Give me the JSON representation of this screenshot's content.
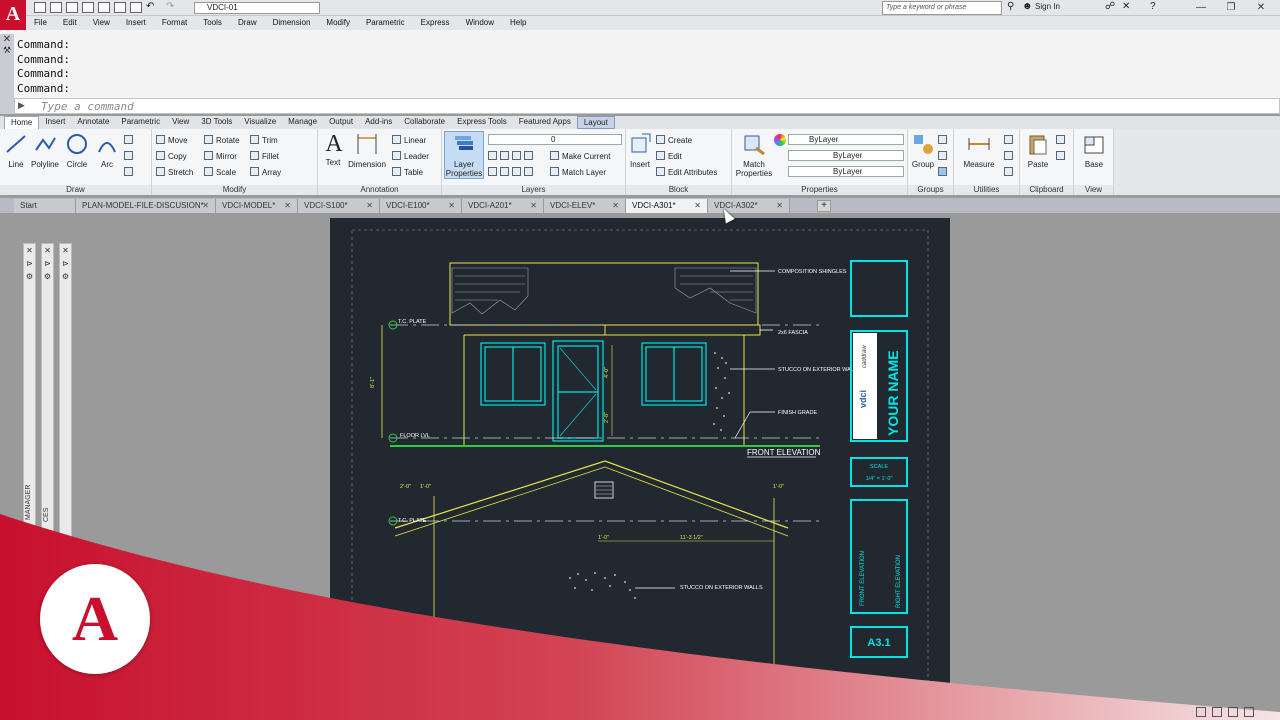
{
  "window": {
    "app_logo": "A",
    "workspace_value": "VDCI-01",
    "search_placeholder": "Type a keyword or phrase",
    "sign_in": "Sign In"
  },
  "menu": [
    "File",
    "Edit",
    "View",
    "Insert",
    "Format",
    "Tools",
    "Draw",
    "Dimension",
    "Modify",
    "Parametric",
    "Express",
    "Window",
    "Help"
  ],
  "command": {
    "history": [
      "Command:",
      "Command:",
      "Command:",
      "Command:"
    ],
    "placeholder": "Type a command"
  },
  "ribbon_tabs": [
    "Home",
    "Insert",
    "Annotate",
    "Parametric",
    "View",
    "3D Tools",
    "Visualize",
    "Manage",
    "Output",
    "Add-ins",
    "Collaborate",
    "Express Tools",
    "Featured Apps",
    "Layout"
  ],
  "ribbon": {
    "draw": {
      "title": "Draw",
      "line": "Line",
      "polyline": "Polyline",
      "circle": "Circle",
      "arc": "Arc"
    },
    "modify": {
      "title": "Modify",
      "move": "Move",
      "rotate": "Rotate",
      "trim": "Trim",
      "copy": "Copy",
      "mirror": "Mirror",
      "fillet": "Fillet",
      "stretch": "Stretch",
      "scale": "Scale",
      "array": "Array"
    },
    "annotation": {
      "title": "Annotation",
      "text": "Text",
      "dimension": "Dimension",
      "linear": "Linear",
      "leader": "Leader",
      "table": "Table"
    },
    "layers": {
      "title": "Layers",
      "layer_properties": "Layer Properties",
      "layer_value": "0",
      "make_current": "Make Current",
      "match_layer": "Match Layer"
    },
    "block": {
      "title": "Block",
      "insert": "Insert",
      "create": "Create",
      "edit": "Edit",
      "edit_attributes": "Edit Attributes"
    },
    "properties": {
      "title": "Properties",
      "match_properties": "Match Properties",
      "color": "ByLayer",
      "linetype": "ByLayer",
      "lineweight": "ByLayer"
    },
    "groups": {
      "title": "Groups",
      "group": "Group"
    },
    "utilities": {
      "title": "Utilities",
      "measure": "Measure"
    },
    "clipboard": {
      "title": "Clipboard",
      "paste": "Paste"
    },
    "view": {
      "title": "View",
      "base": "Base"
    }
  },
  "doc_tabs": [
    "Start",
    "PLAN-MODEL-FILE-DISCUSION*",
    "VDCI-MODEL*",
    "VDCI-S100*",
    "VDCI-E100*",
    "VDCI-A201*",
    "VDCI-ELEV*",
    "VDCI-A301*",
    "VDCI-A302*"
  ],
  "active_doc_tab": "VDCI-A301*",
  "palettes": [
    "MANAGER",
    "CES"
  ],
  "drawing": {
    "labels": {
      "comp_shingles": "COMPOSITION SHINGLES",
      "fascia": "2x6 FASCIA",
      "stucco": "STUCCO ON EXTERIOR WALLS",
      "finish_grade": "FINISH GRADE",
      "tc_plate": "T.C. PLATE",
      "floor_lvl": "FLOOR LVL",
      "front_elevation_title": "FRONT ELEVATION",
      "stucco_2": "STUCCO ON EXTERIOR WALLS",
      "dim_8": "8'-1\"",
      "dim_a": "2'-0\"",
      "dim_b": "11'-3 1/2\"",
      "dim_c": "1'-0\"",
      "dim_d": "4'-0\"",
      "dim_e": "2'-8\""
    },
    "title_block": {
      "company": "caddraw",
      "brand": "vdci",
      "name": "YOUR NAME",
      "scale_label": "SCALE",
      "scale_value": "1/4\" = 1'-0\"",
      "sheet_titles": [
        "FRONT ELEVATION",
        "RIGHT ELEVATION"
      ],
      "sheet_number": "A3.1"
    }
  },
  "colors": {
    "brand_red": "#c8102e",
    "sheet_bg": "#212830",
    "cyan": "#00e5e5",
    "yellow": "#e8e64a",
    "green": "#2ecc40"
  }
}
